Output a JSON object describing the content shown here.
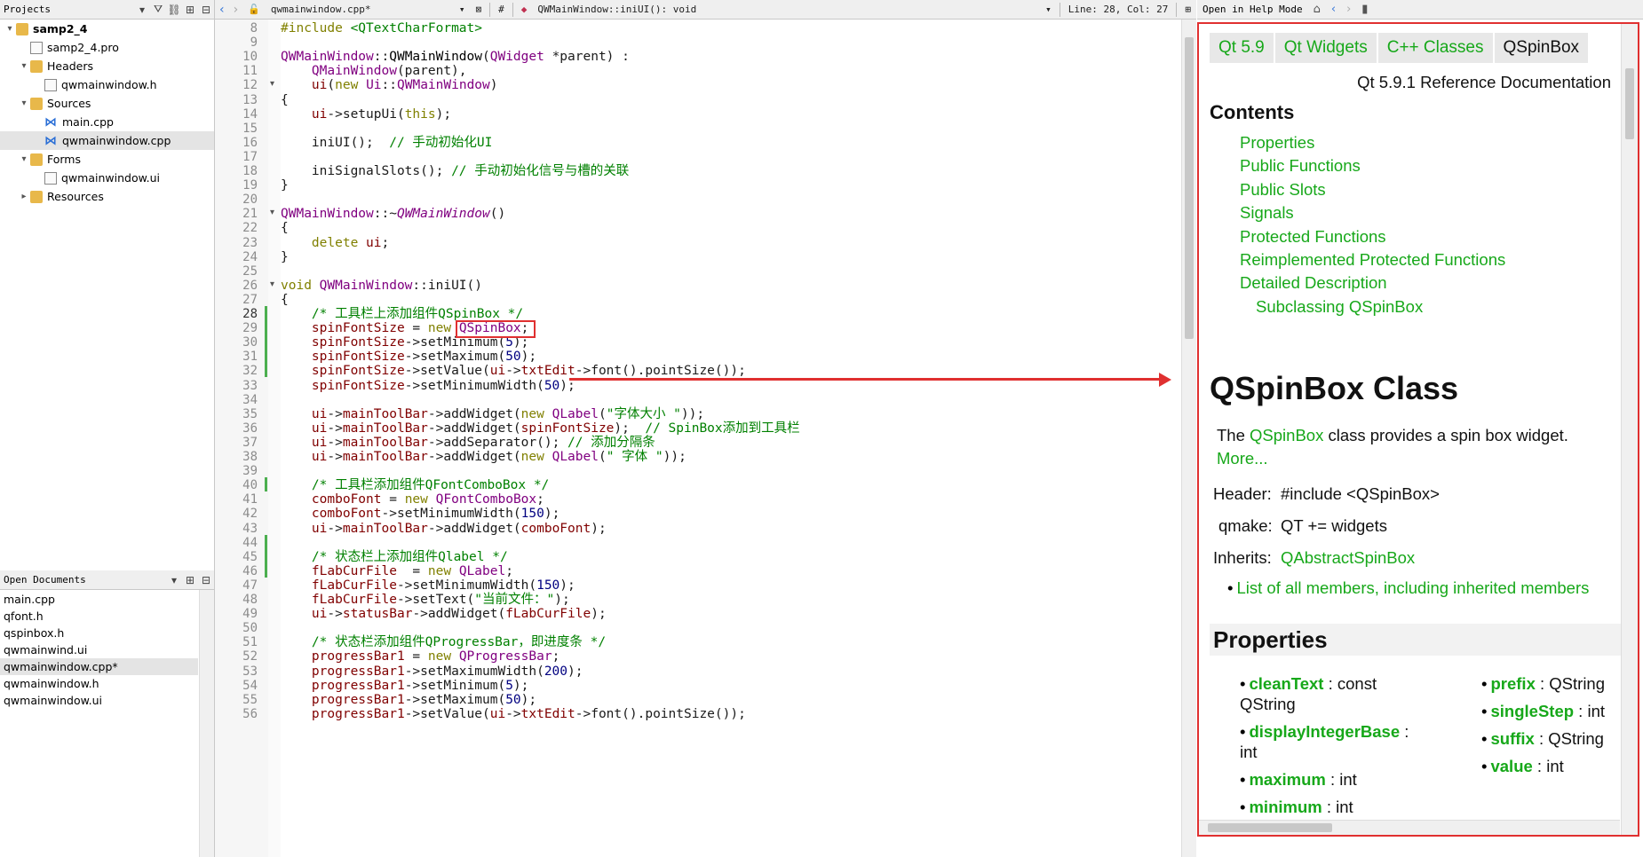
{
  "projects": {
    "header": "Projects",
    "tree": [
      {
        "label": "samp2_4",
        "level": 0,
        "arrow": "▾",
        "icon": "project-icon",
        "bold": true
      },
      {
        "label": "samp2_4.pro",
        "level": 1,
        "arrow": "",
        "icon": "pro-file-icon"
      },
      {
        "label": "Headers",
        "level": 1,
        "arrow": "▾",
        "icon": "folder-icon"
      },
      {
        "label": "qwmainwindow.h",
        "level": 2,
        "arrow": "",
        "icon": "header-file-icon"
      },
      {
        "label": "Sources",
        "level": 1,
        "arrow": "▾",
        "icon": "folder-icon"
      },
      {
        "label": "main.cpp",
        "level": 2,
        "arrow": "",
        "icon": "cpp-file-icon"
      },
      {
        "label": "qwmainwindow.cpp",
        "level": 2,
        "arrow": "",
        "icon": "cpp-file-icon",
        "selected": true
      },
      {
        "label": "Forms",
        "level": 1,
        "arrow": "▾",
        "icon": "folder-icon"
      },
      {
        "label": "qwmainwindow.ui",
        "level": 2,
        "arrow": "",
        "icon": "ui-file-icon"
      },
      {
        "label": "Resources",
        "level": 1,
        "arrow": "▸",
        "icon": "folder-icon"
      }
    ]
  },
  "open_documents": {
    "header": "Open Documents",
    "items": [
      "main.cpp",
      "qfont.h",
      "qspinbox.h",
      "qwmainwind.ui",
      "qwmainwindow.cpp*",
      "qwmainwindow.h",
      "qwmainwindow.ui"
    ],
    "selected_index": 4
  },
  "editor": {
    "file_tab": "qwmainwindow.cpp*",
    "symbol_hash": "#",
    "function": "QWMainWindow::iniUI(): void",
    "position": "Line: 28, Col: 27",
    "current_line": 28,
    "lines": [
      {
        "n": 8,
        "h": [
          [
            "#include ",
            "k"
          ],
          [
            "<QTextCharFormat>",
            "s"
          ]
        ]
      },
      {
        "n": 9,
        "h": []
      },
      {
        "n": 10,
        "h": [
          [
            "QWMainWindow",
            "t"
          ],
          [
            "::",
            ""
          ],
          [
            "QWMainWindow",
            "f"
          ],
          [
            "(",
            ""
          ],
          [
            "QWidget",
            "t"
          ],
          [
            " *parent) :",
            ""
          ]
        ]
      },
      {
        "n": 11,
        "h": [
          [
            "    ",
            ""
          ],
          [
            "QMainWindow",
            "t"
          ],
          [
            "(parent),",
            ""
          ]
        ]
      },
      {
        "n": 12,
        "h": [
          [
            "    ",
            ""
          ],
          [
            "ui",
            "v"
          ],
          [
            "(",
            ""
          ],
          [
            "new",
            "k"
          ],
          [
            " ",
            ""
          ],
          [
            "Ui",
            "t"
          ],
          [
            "::",
            ""
          ],
          [
            "QWMainWindow",
            "t"
          ],
          [
            ")",
            ""
          ]
        ],
        "fold": "▾"
      },
      {
        "n": 13,
        "h": [
          [
            "{",
            ""
          ]
        ]
      },
      {
        "n": 14,
        "h": [
          [
            "    ",
            ""
          ],
          [
            "ui",
            "v"
          ],
          [
            "->setupUi(",
            ""
          ],
          [
            "this",
            "k"
          ],
          [
            ");",
            ""
          ]
        ]
      },
      {
        "n": 15,
        "h": []
      },
      {
        "n": 16,
        "h": [
          [
            "    iniUI();  ",
            ""
          ],
          [
            "// 手动初始化UI",
            "c"
          ]
        ]
      },
      {
        "n": 17,
        "h": []
      },
      {
        "n": 18,
        "h": [
          [
            "    iniSignalSlots(); ",
            ""
          ],
          [
            "// 手动初始化信号与槽的关联",
            "c"
          ]
        ]
      },
      {
        "n": 19,
        "h": [
          [
            "}",
            ""
          ]
        ]
      },
      {
        "n": 20,
        "h": []
      },
      {
        "n": 21,
        "h": [
          [
            "QWMainWindow",
            "t"
          ],
          [
            "::~",
            ""
          ],
          [
            "QWMainWindow",
            "i"
          ],
          [
            "()",
            ""
          ]
        ],
        "fold": "▾"
      },
      {
        "n": 22,
        "h": [
          [
            "{",
            ""
          ]
        ]
      },
      {
        "n": 23,
        "h": [
          [
            "    ",
            ""
          ],
          [
            "delete",
            "k"
          ],
          [
            " ",
            ""
          ],
          [
            "ui",
            "v"
          ],
          [
            ";",
            ""
          ]
        ]
      },
      {
        "n": 24,
        "h": [
          [
            "}",
            ""
          ]
        ]
      },
      {
        "n": 25,
        "h": []
      },
      {
        "n": 26,
        "h": [
          [
            "void",
            "k"
          ],
          [
            " ",
            ""
          ],
          [
            "QWMainWindow",
            "t"
          ],
          [
            "::iniUI()",
            ""
          ]
        ],
        "fold": "▾"
      },
      {
        "n": 27,
        "h": [
          [
            "{",
            ""
          ]
        ]
      },
      {
        "n": 28,
        "h": [
          [
            "    ",
            ""
          ],
          [
            "/* 工具栏上添加组件QSpinBox */",
            "c"
          ]
        ],
        "mod": true
      },
      {
        "n": 29,
        "h": [
          [
            "    ",
            ""
          ],
          [
            "spinFontSize",
            "v"
          ],
          [
            " = ",
            ""
          ],
          [
            "new",
            "k"
          ],
          [
            " ",
            ""
          ],
          [
            "QSpinBox",
            "t"
          ],
          [
            ";",
            ""
          ]
        ],
        "mod": true
      },
      {
        "n": 30,
        "h": [
          [
            "    ",
            ""
          ],
          [
            "spinFontSize",
            "v"
          ],
          [
            "->setMinimum(",
            ""
          ],
          [
            "5",
            "n"
          ],
          [
            ");",
            ""
          ]
        ],
        "mod": true
      },
      {
        "n": 31,
        "h": [
          [
            "    ",
            ""
          ],
          [
            "spinFontSize",
            "v"
          ],
          [
            "->setMaximum(",
            ""
          ],
          [
            "50",
            "n"
          ],
          [
            ");",
            ""
          ]
        ],
        "mod": true
      },
      {
        "n": 32,
        "h": [
          [
            "    ",
            ""
          ],
          [
            "spinFontSize",
            "v"
          ],
          [
            "->setValue(",
            ""
          ],
          [
            "ui",
            "v"
          ],
          [
            "->",
            ""
          ],
          [
            "txtEdit",
            "v"
          ],
          [
            "->font().pointSize());",
            ""
          ]
        ],
        "mod": true
      },
      {
        "n": 33,
        "h": [
          [
            "    ",
            ""
          ],
          [
            "spinFontSize",
            "v"
          ],
          [
            "->setMinimumWidth(",
            ""
          ],
          [
            "50",
            "n"
          ],
          [
            ");",
            ""
          ]
        ]
      },
      {
        "n": 34,
        "h": []
      },
      {
        "n": 35,
        "h": [
          [
            "    ",
            ""
          ],
          [
            "ui",
            "v"
          ],
          [
            "->",
            ""
          ],
          [
            "mainToolBar",
            "v"
          ],
          [
            "->addWidget(",
            ""
          ],
          [
            "new",
            "k"
          ],
          [
            " ",
            ""
          ],
          [
            "QLabel",
            "t"
          ],
          [
            "(",
            ""
          ],
          [
            "\"字体大小 \"",
            "s"
          ],
          [
            "));",
            ""
          ]
        ]
      },
      {
        "n": 36,
        "h": [
          [
            "    ",
            ""
          ],
          [
            "ui",
            "v"
          ],
          [
            "->",
            ""
          ],
          [
            "mainToolBar",
            "v"
          ],
          [
            "->addWidget(",
            ""
          ],
          [
            "spinFontSize",
            "v"
          ],
          [
            ");  ",
            ""
          ],
          [
            "// SpinBox添加到工具栏",
            "c"
          ]
        ]
      },
      {
        "n": 37,
        "h": [
          [
            "    ",
            ""
          ],
          [
            "ui",
            "v"
          ],
          [
            "->",
            ""
          ],
          [
            "mainToolBar",
            "v"
          ],
          [
            "->addSeparator(); ",
            ""
          ],
          [
            "// 添加分隔条",
            "c"
          ]
        ]
      },
      {
        "n": 38,
        "h": [
          [
            "    ",
            ""
          ],
          [
            "ui",
            "v"
          ],
          [
            "->",
            ""
          ],
          [
            "mainToolBar",
            "v"
          ],
          [
            "->addWidget(",
            ""
          ],
          [
            "new",
            "k"
          ],
          [
            " ",
            ""
          ],
          [
            "QLabel",
            "t"
          ],
          [
            "(",
            ""
          ],
          [
            "\" 字体 \"",
            "s"
          ],
          [
            "));",
            ""
          ]
        ]
      },
      {
        "n": 39,
        "h": []
      },
      {
        "n": 40,
        "h": [
          [
            "    ",
            ""
          ],
          [
            "/* 工具栏添加组件QFontComboBox */",
            "c"
          ]
        ],
        "mod": true
      },
      {
        "n": 41,
        "h": [
          [
            "    ",
            ""
          ],
          [
            "comboFont",
            "v"
          ],
          [
            " = ",
            ""
          ],
          [
            "new",
            "k"
          ],
          [
            " ",
            ""
          ],
          [
            "QFontComboBox",
            "t"
          ],
          [
            ";",
            ""
          ]
        ]
      },
      {
        "n": 42,
        "h": [
          [
            "    ",
            ""
          ],
          [
            "comboFont",
            "v"
          ],
          [
            "->setMinimumWidth(",
            ""
          ],
          [
            "150",
            "n"
          ],
          [
            ");",
            ""
          ]
        ]
      },
      {
        "n": 43,
        "h": [
          [
            "    ",
            ""
          ],
          [
            "ui",
            "v"
          ],
          [
            "->",
            ""
          ],
          [
            "mainToolBar",
            "v"
          ],
          [
            "->addWidget(",
            ""
          ],
          [
            "comboFont",
            "v"
          ],
          [
            ");",
            ""
          ]
        ]
      },
      {
        "n": 44,
        "h": [],
        "mod": true
      },
      {
        "n": 45,
        "h": [
          [
            "    ",
            ""
          ],
          [
            "/* 状态栏上添加组件Qlabel */",
            "c"
          ]
        ],
        "mod": true
      },
      {
        "n": 46,
        "h": [
          [
            "    ",
            ""
          ],
          [
            "fLabCurFile",
            "v"
          ],
          [
            "  = ",
            ""
          ],
          [
            "new",
            "k"
          ],
          [
            " ",
            ""
          ],
          [
            "QLabel",
            "t"
          ],
          [
            ";",
            ""
          ]
        ],
        "mod": true
      },
      {
        "n": 47,
        "h": [
          [
            "    ",
            ""
          ],
          [
            "fLabCurFile",
            "v"
          ],
          [
            "->setMinimumWidth(",
            ""
          ],
          [
            "150",
            "n"
          ],
          [
            ");",
            ""
          ]
        ]
      },
      {
        "n": 48,
        "h": [
          [
            "    ",
            ""
          ],
          [
            "fLabCurFile",
            "v"
          ],
          [
            "->setText(",
            ""
          ],
          [
            "\"当前文件：\"",
            "s"
          ],
          [
            ");",
            ""
          ]
        ]
      },
      {
        "n": 49,
        "h": [
          [
            "    ",
            ""
          ],
          [
            "ui",
            "v"
          ],
          [
            "->",
            ""
          ],
          [
            "statusBar",
            "v"
          ],
          [
            "->addWidget(",
            ""
          ],
          [
            "fLabCurFile",
            "v"
          ],
          [
            ");",
            ""
          ]
        ]
      },
      {
        "n": 50,
        "h": []
      },
      {
        "n": 51,
        "h": [
          [
            "    ",
            ""
          ],
          [
            "/* 状态栏添加组件QProgressBar，即进度条 */",
            "c"
          ]
        ]
      },
      {
        "n": 52,
        "h": [
          [
            "    ",
            ""
          ],
          [
            "progressBar1",
            "v"
          ],
          [
            " = ",
            ""
          ],
          [
            "new",
            "k"
          ],
          [
            " ",
            ""
          ],
          [
            "QProgressBar",
            "t"
          ],
          [
            ";",
            ""
          ]
        ]
      },
      {
        "n": 53,
        "h": [
          [
            "    ",
            ""
          ],
          [
            "progressBar1",
            "v"
          ],
          [
            "->setMaximumWidth(",
            ""
          ],
          [
            "200",
            "n"
          ],
          [
            ");",
            ""
          ]
        ]
      },
      {
        "n": 54,
        "h": [
          [
            "    ",
            ""
          ],
          [
            "progressBar1",
            "v"
          ],
          [
            "->setMinimum(",
            ""
          ],
          [
            "5",
            "n"
          ],
          [
            ");",
            ""
          ]
        ]
      },
      {
        "n": 55,
        "h": [
          [
            "    ",
            ""
          ],
          [
            "progressBar1",
            "v"
          ],
          [
            "->setMaximum(",
            ""
          ],
          [
            "50",
            "n"
          ],
          [
            ");",
            ""
          ]
        ]
      },
      {
        "n": 56,
        "h": [
          [
            "    ",
            ""
          ],
          [
            "progressBar1",
            "v"
          ],
          [
            "->setValue(",
            ""
          ],
          [
            "ui",
            "v"
          ],
          [
            "->",
            ""
          ],
          [
            "txtEdit",
            "v"
          ],
          [
            "->font().pointSize());",
            ""
          ]
        ]
      }
    ]
  },
  "help": {
    "mode_label": "Open in Help Mode",
    "crumbs": [
      "Qt 5.9",
      "Qt Widgets",
      "C++ Classes",
      "QSpinBox"
    ],
    "ref_doc": "Qt 5.9.1 Reference Documentation",
    "contents_title": "Contents",
    "toc": [
      "Properties",
      "Public Functions",
      "Public Slots",
      "Signals",
      "Protected Functions",
      "Reimplemented Protected Functions",
      "Detailed Description",
      "Subclassing QSpinBox"
    ],
    "class_title": "QSpinBox Class",
    "intro_prefix": "The ",
    "intro_link": "QSpinBox",
    "intro_suffix": " class provides a spin box widget.",
    "more": "More...",
    "header_label": "Header:",
    "header_value": "#include <QSpinBox>",
    "qmake_label": "qmake:",
    "qmake_value": "QT += widgets",
    "inherits_label": "Inherits:",
    "inherits_value": "QAbstractSpinBox",
    "all_members": "List of all members, including inherited members",
    "properties_title": "Properties",
    "properties_left": [
      {
        "name": "cleanText",
        "type": " : const QString"
      },
      {
        "name": "displayIntegerBase",
        "type": " : int"
      },
      {
        "name": "maximum",
        "type": " : int"
      },
      {
        "name": "minimum",
        "type": " : int"
      }
    ],
    "properties_right": [
      {
        "name": "prefix",
        "type": " : QString"
      },
      {
        "name": "singleStep",
        "type": " : int"
      },
      {
        "name": "suffix",
        "type": " : QString"
      },
      {
        "name": "value",
        "type": " : int"
      }
    ]
  }
}
